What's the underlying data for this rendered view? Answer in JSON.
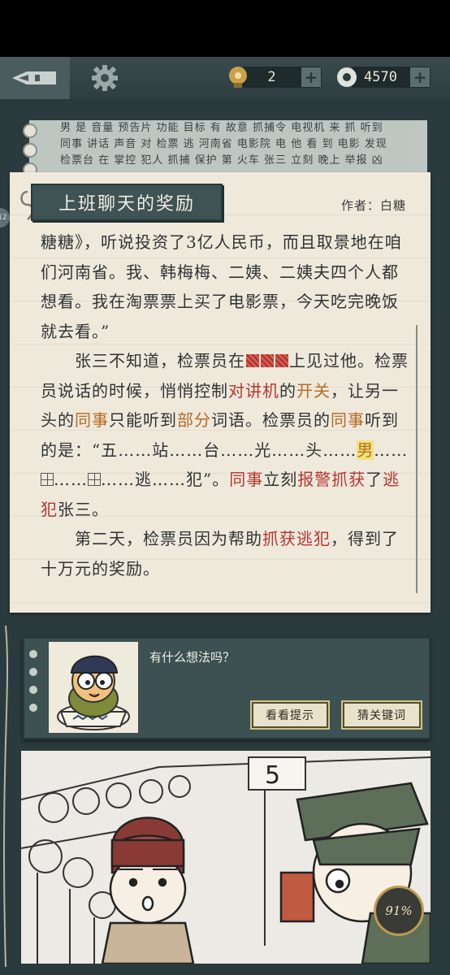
{
  "topbar": {
    "hints": "2",
    "coins": "4570",
    "plus": "+"
  },
  "background_paper": {
    "lines": [
      "男 是 音量 预告片 功能 目标 有 故意 抓捕令 电视机 来 抓 听到",
      "同事 讲话 声音 对 检票 逃 河南省 电影院 电 他 看 到 电影 发现",
      "检票台 在 掌控 犯人 抓捕 保护 第 火车 张三 立刻 晚上 举报 凶"
    ]
  },
  "story": {
    "title": "上班聊天的奖励",
    "author": "作者：白糖",
    "p1_a": "糖糖》，听说投资了3亿人民币，而且取景地在咱们河南省。我、韩梅梅、二姨、二姨夫四个人都想看。我在淘票票上买了电影票，今天吃完晚饭就去看。”",
    "p2_a": "张三不知道，检票员在",
    "p2_b": "上见过他。检票员说话的时候，悄悄控制",
    "p2_c": "对讲机",
    "p2_d": "的",
    "p2_e": "开关",
    "p2_f": "，让另一头的",
    "p2_g": "同事",
    "p2_h": "只能听到",
    "p2_i": "部分",
    "p2_j": "词语。检票员的",
    "p2_k": "同事",
    "p2_l": "听到的是：“五……站……台……光……头……",
    "p2_m": "男",
    "p2_n": "……",
    "p2_o": "……",
    "p2_p": "……逃……犯”。",
    "p2_q": "同事",
    "p2_r": "立刻",
    "p2_s": "报警抓获",
    "p2_t": "了",
    "p2_u": "逃犯",
    "p2_v": "张三。",
    "p3_a": "第二天，检票员因为帮助",
    "p3_b": "抓获逃犯",
    "p3_c": "，得到了十万元的奖励。"
  },
  "dialog": {
    "question": "有什么想法吗？",
    "hint_button": "看看提示",
    "keyword_button": "猜关键词"
  },
  "comic": {
    "sign_number": "5",
    "progress": "91%"
  },
  "side_badge": "12",
  "colors": {
    "keyword_red": "#b8352f",
    "keyword_orange": "#b86a23",
    "highlight": "#f2e37a",
    "panel": "#3d5052"
  }
}
